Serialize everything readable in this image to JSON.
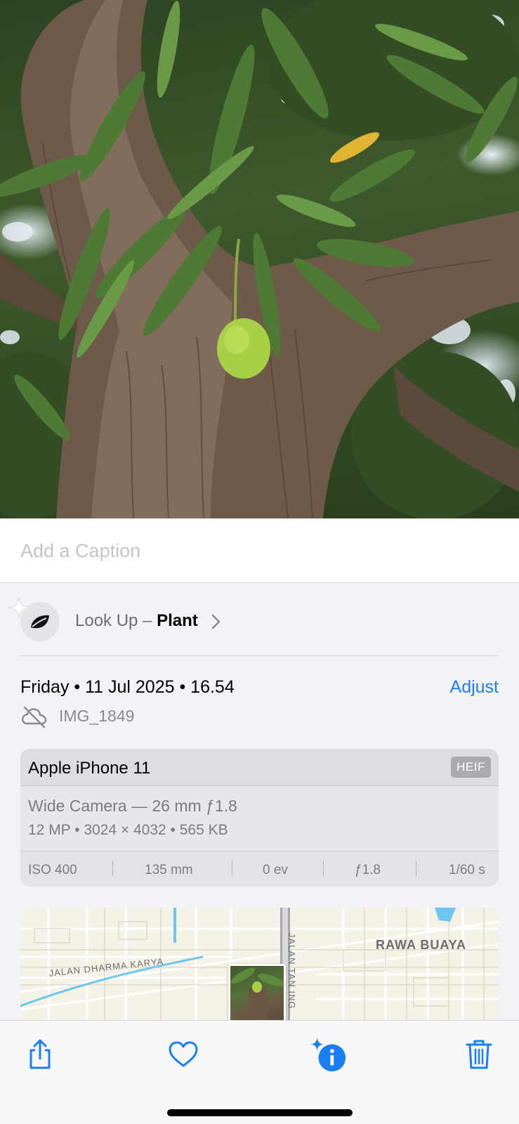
{
  "photo": {
    "subject_icon": "mango-tree-photo"
  },
  "caption": {
    "placeholder": "Add a Caption",
    "value": ""
  },
  "lookup": {
    "prefix": "Look Up – ",
    "subject": "Plant",
    "icon": "leaf-icon"
  },
  "info": {
    "date": "Friday • 11 Jul 2025 • 16.54",
    "adjust_label": "Adjust",
    "filename": "IMG_1849",
    "cloud_icon": "cloud-slash-icon"
  },
  "camera": {
    "device": "Apple iPhone 11",
    "format": "HEIF",
    "lens": "Wide Camera — 26 mm ƒ1.8",
    "specs": "12 MP  •  3024 × 4032  •  565 KB",
    "exif": {
      "iso": "ISO 400",
      "focal": "135 mm",
      "ev": "0 ev",
      "aperture": "ƒ1.8",
      "shutter": "1/60 s"
    }
  },
  "map": {
    "label_area": "RAWA BUAYA",
    "label_road": "JALAN DHARMA KARYA",
    "label_road_vertical": "JALAN TAN ING"
  },
  "toolbar": {
    "share": "share-icon",
    "favorite": "heart-icon",
    "info": "info-sparkle-icon",
    "delete": "trash-icon",
    "accent": "#1a7ff5"
  }
}
